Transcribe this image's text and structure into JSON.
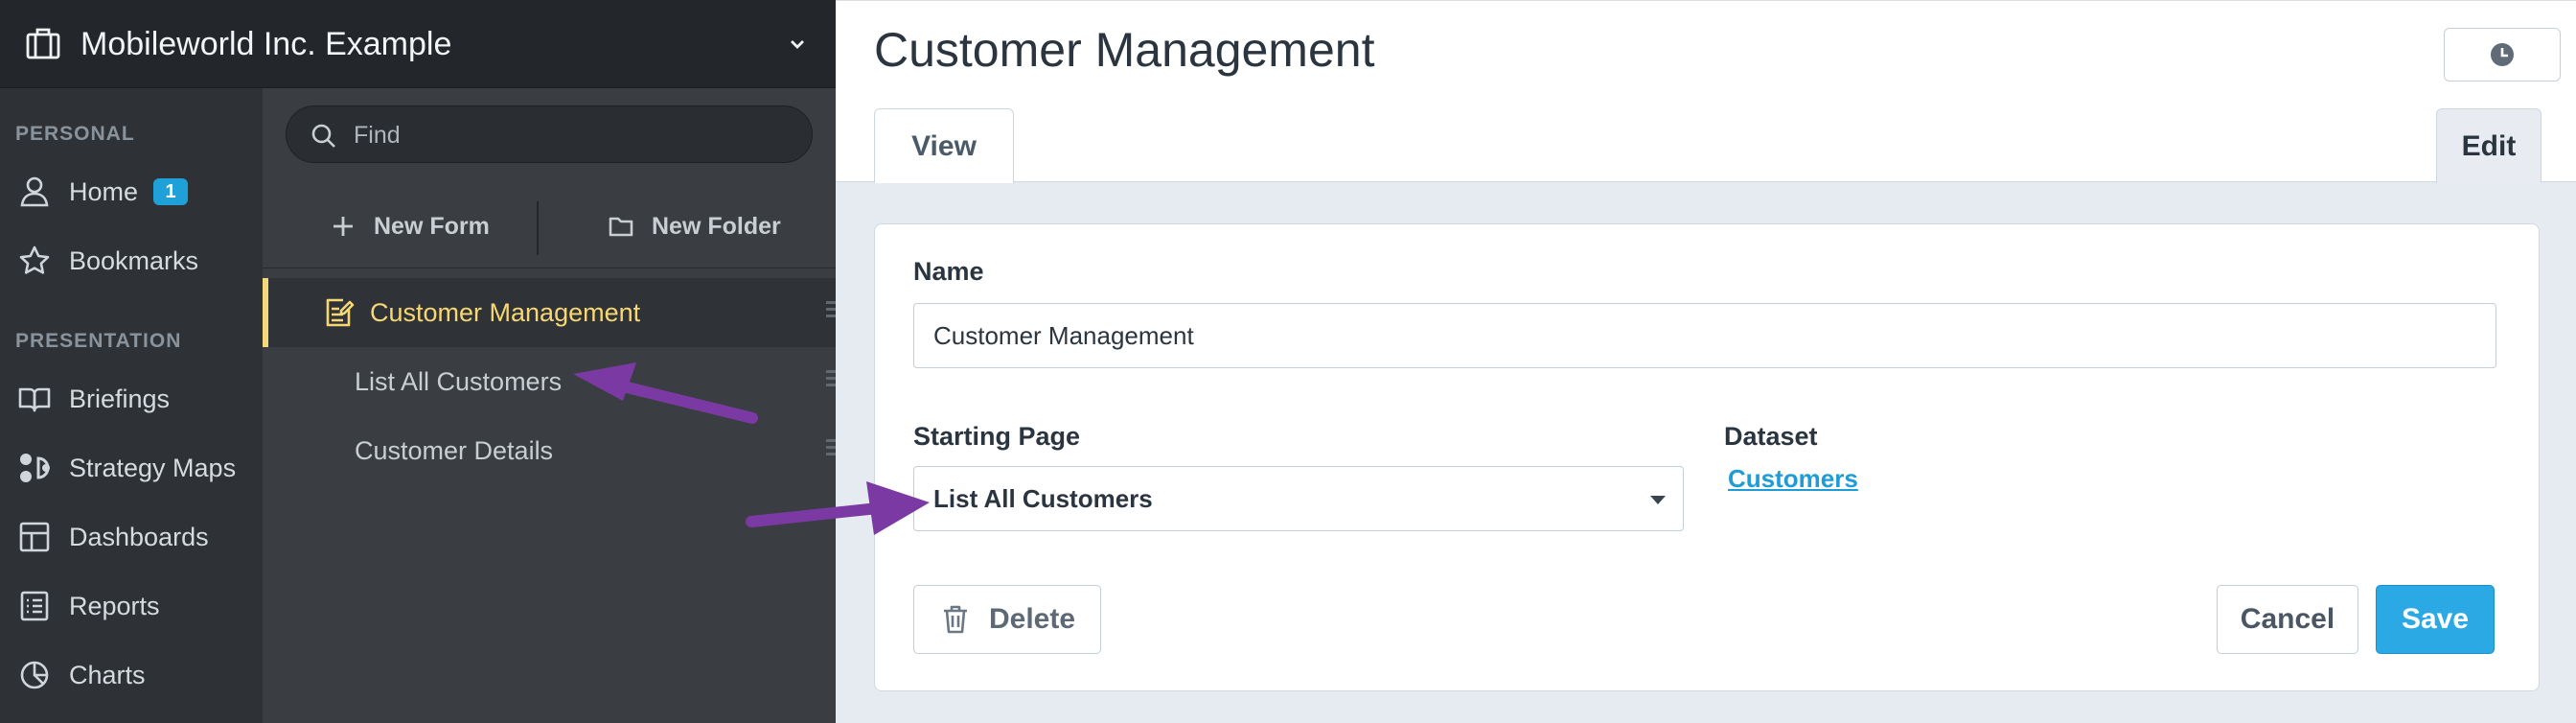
{
  "org": {
    "name": "Mobileworld Inc. Example",
    "icon": "briefcase-icon"
  },
  "sidebar": {
    "personal_label": "PERSONAL",
    "presentation_label": "PRESENTATION",
    "items": [
      {
        "label": "Home",
        "icon": "user-icon",
        "badge": "1"
      },
      {
        "label": "Bookmarks",
        "icon": "star-icon"
      },
      {
        "label": "Briefings",
        "icon": "book-icon"
      },
      {
        "label": "Strategy Maps",
        "icon": "strategy-map-icon"
      },
      {
        "label": "Dashboards",
        "icon": "dashboard-icon"
      },
      {
        "label": "Reports",
        "icon": "report-icon"
      },
      {
        "label": "Charts",
        "icon": "pie-chart-icon"
      }
    ]
  },
  "tree": {
    "search": {
      "placeholder": "Find",
      "value": ""
    },
    "new_form_label": "New Form",
    "new_folder_label": "New Folder",
    "items": [
      {
        "label": "Customer Management",
        "icon": "form-icon",
        "active": true
      },
      {
        "label": "List All Customers"
      },
      {
        "label": "Customer Details"
      }
    ]
  },
  "main": {
    "title": "Customer Management",
    "tabs": {
      "view": "View",
      "edit": "Edit"
    },
    "form": {
      "name_label": "Name",
      "name_value": "Customer Management",
      "starting_page_label": "Starting Page",
      "starting_page_value": "List All Customers",
      "dataset_label": "Dataset",
      "dataset_value": "Customers"
    },
    "buttons": {
      "delete": "Delete",
      "cancel": "Cancel",
      "save": "Save"
    }
  },
  "colors": {
    "accent": "#2ba9e4",
    "active_item": "#f7d774",
    "annotation_arrow": "#7b3aa3"
  }
}
